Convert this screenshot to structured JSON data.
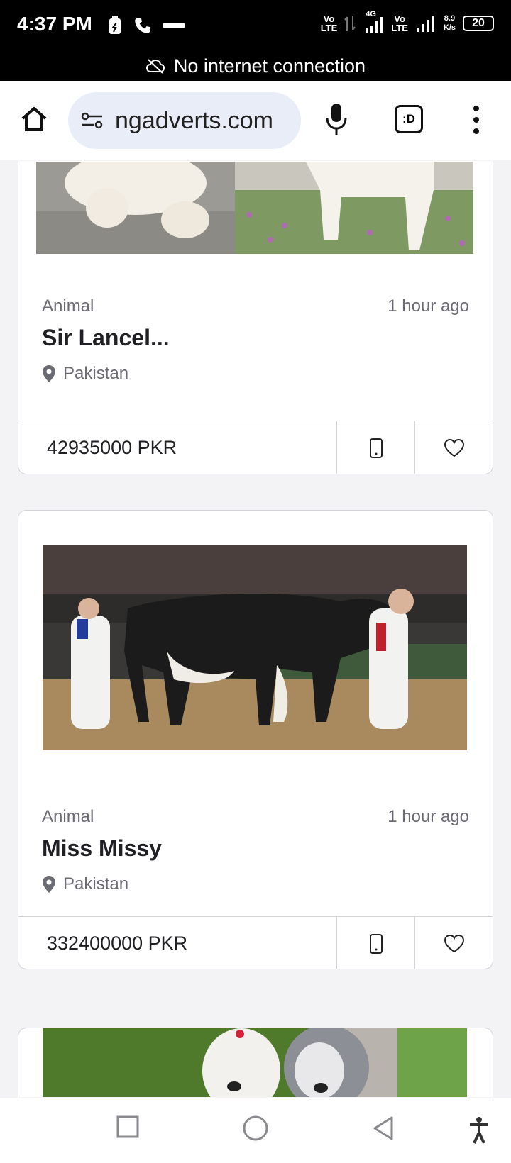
{
  "status_bar": {
    "time": "4:37 PM",
    "net_speed_value": "8.9",
    "net_speed_unit": "K/s",
    "battery": "20",
    "volte1": "Vo",
    "lte1": "LTE",
    "volte2": "Vo",
    "lte2": "LTE",
    "net_4g": "4G"
  },
  "banner": {
    "text": "No internet connection"
  },
  "browser": {
    "url": "ngadverts.com",
    "tab_label": ":D"
  },
  "listings": [
    {
      "category": "Animal",
      "time": "1 hour ago",
      "title": "Sir Lancel...",
      "location": "Pakistan",
      "price": "42935000 PKR"
    },
    {
      "category": "Animal",
      "time": "1 hour ago",
      "title": "Miss Missy",
      "location": "Pakistan",
      "price": "332400000 PKR"
    }
  ],
  "colors": {
    "status_bg": "#000000",
    "url_bg": "#e9edf7",
    "text_dark": "#1f1f24",
    "text_muted": "#6b6b73"
  }
}
